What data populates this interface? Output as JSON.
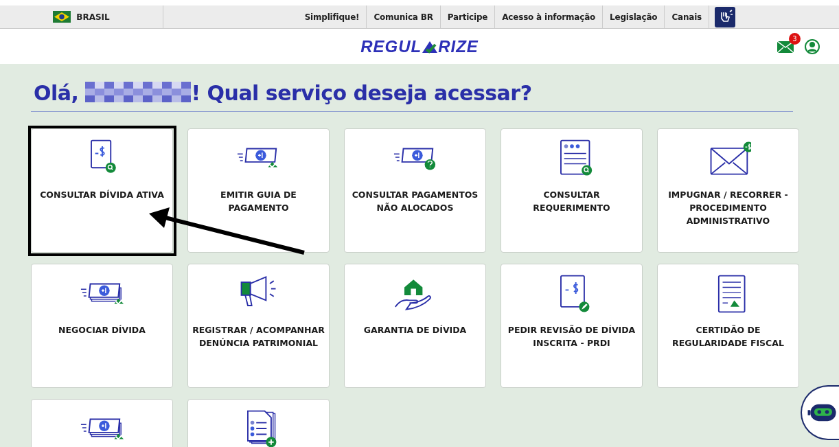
{
  "gov_bar": {
    "country": "BRASIL",
    "links": [
      "Simplifique!",
      "Comunica BR",
      "Participe",
      "Acesso à informação",
      "Legislação",
      "Canais"
    ]
  },
  "header": {
    "logo_start": "REGUL",
    "logo_end": "RIZE",
    "unread_count": "3"
  },
  "greeting": {
    "prefix": "Olá,",
    "suffix": "! Qual serviço deseja acessar?"
  },
  "services": [
    {
      "label": "CONSULTAR DÍVIDA ATIVA",
      "kind": "doc-search",
      "highlighted": true
    },
    {
      "label": "EMITIR GUIA DE PAGAMENTO",
      "kind": "bill-check",
      "highlighted": false
    },
    {
      "label": "CONSULTAR PAGAMENTOS NÃO ALOCADOS",
      "kind": "bill-question",
      "highlighted": false
    },
    {
      "label": "CONSULTAR REQUERIMENTO",
      "kind": "list-search",
      "highlighted": false
    },
    {
      "label": "IMPUGNAR / RECORRER - PROCEDIMENTO ADMINISTRATIVO",
      "kind": "envelope",
      "highlighted": false
    },
    {
      "label": "NEGOCIAR DÍVIDA",
      "kind": "stack-check",
      "highlighted": false
    },
    {
      "label": "REGISTRAR / ACOMPANHAR DENÚNCIA PATRIMONIAL",
      "kind": "megaphone",
      "highlighted": false
    },
    {
      "label": "GARANTIA DE DÍVIDA",
      "kind": "house-hand",
      "highlighted": false
    },
    {
      "label": "PEDIR REVISÃO DE DÍVIDA INSCRITA - PRDI",
      "kind": "doc-edit",
      "highlighted": false
    },
    {
      "label": "CERTIDÃO DE REGULARIDADE FISCAL",
      "kind": "certificate",
      "highlighted": false
    },
    {
      "kind": "stack-check",
      "highlighted": false
    },
    {
      "kind": "docs-plus",
      "highlighted": false
    }
  ]
}
